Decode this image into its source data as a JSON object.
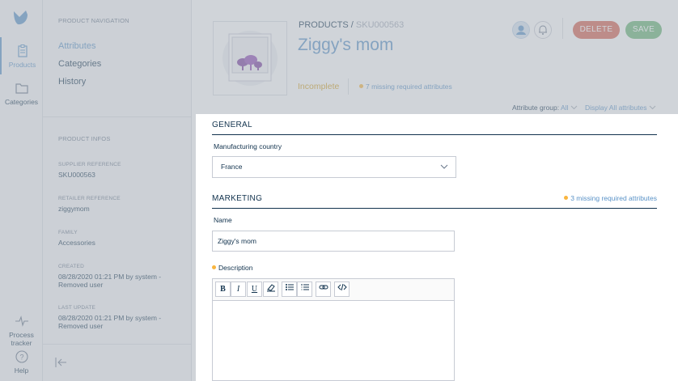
{
  "rail": {
    "products_label": "Products",
    "categories_label": "Categories",
    "tracker_label": "Process tracker",
    "help_label": "Help"
  },
  "panel": {
    "nav_title": "PRODUCT NAVIGATION",
    "nav_items": [
      "Attributes",
      "Categories",
      "History"
    ],
    "info_title": "PRODUCT INFOS",
    "infos": [
      {
        "label": "SUPPLIER REFERENCE",
        "value": "SKU000563"
      },
      {
        "label": "RETAILER REFERENCE",
        "value": "ziggymom"
      },
      {
        "label": "FAMILY",
        "value": "Accessories"
      },
      {
        "label": "CREATED",
        "value": "08/28/2020 01:21 PM by system - Removed user"
      },
      {
        "label": "LAST UPDATE",
        "value": "08/28/2020 01:21 PM by system - Removed user"
      }
    ]
  },
  "header": {
    "breadcrumb_root": "PRODUCTS",
    "breadcrumb_sep": "/",
    "breadcrumb_sku": "SKU000563",
    "title": "Ziggy's mom",
    "status": "Incomplete",
    "missing": "7 missing required attributes",
    "delete_label": "DELETE",
    "save_label": "SAVE"
  },
  "filters": {
    "attr_group_label": "Attribute group:",
    "attr_group_value": "All",
    "display_all": "Display All attributes"
  },
  "form": {
    "general_title": "GENERAL",
    "country_label": "Manufacturing country",
    "country_value": "France",
    "marketing_title": "MARKETING",
    "marketing_missing": "3 missing required attributes",
    "name_label": "Name",
    "name_value": "Ziggy's mom",
    "description_label": "Description",
    "toolbar": [
      "B",
      "I",
      "U"
    ]
  },
  "colors": {
    "accent": "#5992c7",
    "delete": "#d4604f",
    "save": "#67b373",
    "warning": "#f9b53f",
    "incomplete": "#d4a225"
  }
}
